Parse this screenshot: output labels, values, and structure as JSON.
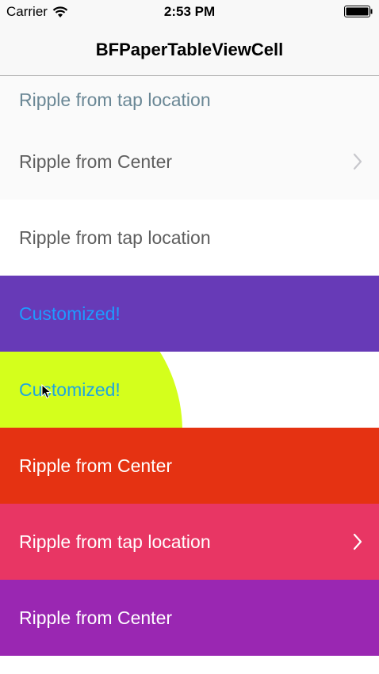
{
  "status_bar": {
    "carrier": "Carrier",
    "time": "2:53 PM"
  },
  "nav": {
    "title": "BFPaperTableViewCell"
  },
  "cells": [
    {
      "label": "Ripple from tap location",
      "bg": "#fafafa",
      "text_color": "#6a8795",
      "chevron": false
    },
    {
      "label": "Ripple from Center",
      "bg": "#fafafa",
      "text_color": "#5e5e5e",
      "chevron": true,
      "chevron_color": "#c7c7cc"
    },
    {
      "label": "Ripple from tap location",
      "bg": "#ffffff",
      "text_color": "#5e5e5e",
      "chevron": false
    },
    {
      "label": "Customized!",
      "bg": "#673ab7",
      "text_color": "#1e9bff",
      "chevron": false
    },
    {
      "label": "Customized!",
      "bg": "#ffffff",
      "text_color": "#1ea5e0",
      "chevron": false,
      "ripple_color": "#d4ff1c"
    },
    {
      "label": "Ripple from Center",
      "bg": "#e53212",
      "text_color": "#ffffff",
      "chevron": false
    },
    {
      "label": "Ripple from tap location",
      "bg": "#e83664",
      "text_color": "#ffffff",
      "chevron": true,
      "chevron_color": "#ffffff"
    },
    {
      "label": "Ripple from Center",
      "bg": "#9a27b2",
      "text_color": "#ffffff",
      "chevron": false
    }
  ]
}
